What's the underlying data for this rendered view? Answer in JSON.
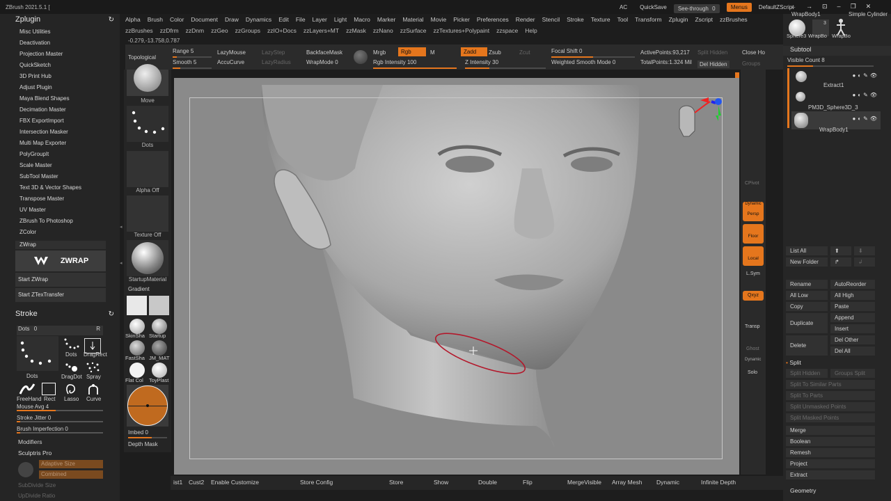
{
  "window": {
    "title": "ZBrush 2021.5.1 ["
  },
  "topright": {
    "ac": "AC",
    "quicksave": "QuickSave",
    "seethrough_label": "See-through",
    "seethrough_value": "0",
    "menus": "Menus",
    "script": "DefaultZScript"
  },
  "menubar": [
    "Alpha",
    "Brush",
    "Color",
    "Document",
    "Draw",
    "Dynamics",
    "Edit",
    "File",
    "Layer",
    "Light",
    "Macro",
    "Marker",
    "Material",
    "Movie",
    "Picker",
    "Preferences",
    "Render",
    "Stencil",
    "Stroke",
    "Texture",
    "Tool",
    "Transform",
    "Zplugin",
    "Zscript",
    "zzBrushes"
  ],
  "pluginbar": [
    "zzBrushes",
    "zzDfrm",
    "zzDnm",
    "zzGeo",
    "zzGroups",
    "zzIO+Docs",
    "zzLayers+MT",
    "zzMask",
    "zzNano",
    "zzSurface",
    "zzTextures+Polypaint",
    "zzspace",
    "Help"
  ],
  "coords": "-0.279,-13.758,0.787",
  "zplugin": {
    "title": "Zplugin",
    "items": [
      "Misc Utilities",
      "Deactivation",
      "Projection Master",
      "QuickSketch",
      "3D Print Hub",
      "Adjust Plugin",
      "Maya Blend Shapes",
      "Decimation Master",
      "FBX ExportImport",
      "Intersection Masker",
      "Multi Map Exporter",
      "PolyGroupIt",
      "Scale Master",
      "SubTool Master",
      "Text 3D & Vector Shapes",
      "Transpose Master",
      "UV Master",
      "ZBrush To Photoshop",
      "ZColor"
    ],
    "zwrap": "ZWrap",
    "zwrap_logo": "ZWRAP",
    "start_zwrap": "Start ZWrap",
    "start_ztex": "Start ZTexTransfer"
  },
  "stroke": {
    "title": "Stroke",
    "dots": "Dots",
    "dots_value": "0",
    "r": "R",
    "labels": [
      "Dots",
      "DragRect",
      "Dots",
      "DragDot",
      "Spray",
      "FreeHand",
      "Rect",
      "Lasso",
      "Curve"
    ],
    "mouse_avg": "Mouse Avg",
    "mouse_avg_value": "4",
    "jitter": "Stroke Jitter",
    "jitter_value": "0",
    "imperfection": "Brush Imperfection",
    "imperfection_value": "0",
    "modifiers": "Modifiers",
    "sculptris": "Sculptris Pro",
    "adaptive": "Adaptive Size",
    "combined": "Combined",
    "subdivide": "SubDivide Size",
    "updivide": "UpDivide Ratio"
  },
  "toolbar": {
    "topological": "Topological",
    "range": "Range",
    "range_value": "5",
    "smooth": "Smooth",
    "smooth_value": "5",
    "lazymouse": "LazyMouse",
    "accucurve": "AccuCurve",
    "lazystep": "LazyStep",
    "lazyradius": "LazyRadius",
    "backfacemask": "BackfaceMask",
    "wrapmode": "WrapMode",
    "wrapmode_value": "0",
    "mrgb": "Mrgb",
    "rgb": "Rgb",
    "m": "M",
    "rgb_intensity": "Rgb Intensity",
    "rgb_intensity_value": "100",
    "zadd": "Zadd",
    "zsub": "Zsub",
    "zcut": "Zcut",
    "z_intensity": "Z Intensity",
    "z_intensity_value": "30",
    "focal": "Focal Shift",
    "focal_value": "0",
    "weighted": "Weighted Smooth Mode",
    "weighted_value": "0",
    "active": "ActivePoints:",
    "active_value": "93,217",
    "total": "TotalPoints:",
    "total_value": "1.324 Mil",
    "split_hidden": "Split Hidden",
    "del_hidden": "Del Hidden",
    "close_holes": "Close Ho",
    "groups": "Groups"
  },
  "shelf": {
    "move": "Move",
    "dots": "Dots",
    "alpha": "Alpha Off",
    "texture": "Texture Off",
    "material": "StartupMaterial",
    "gradient": "Gradient",
    "mats": [
      "SkinSha",
      "Startup",
      "FastSha",
      "JM_MAT",
      "Flat Col",
      "ToyPlast"
    ],
    "imbed": "Imbed",
    "imbed_value": "0",
    "depth": "Depth Mask"
  },
  "rightstrip": {
    "cpivot": "CPivot",
    "persp": "Persp",
    "dynamic": "Dynamic",
    "floor": "Floor",
    "local": "Local",
    "lsym": "L.Sym",
    "xyz": "Qxyz",
    "transp": "Transp",
    "ghost": "Ghost",
    "solo": "Solo",
    "dynamic2": "Dynamic"
  },
  "subtool": {
    "top_names": [
      "WrapBody1",
      "Simple Cylinder",
      "Sphere3",
      "WrapBo",
      "WrapBo"
    ],
    "top_num": "3",
    "title": "Subtool",
    "visible": "Visible Count",
    "visible_value": "8",
    "items": [
      "Extract1",
      "PM3D_Sphere3D_3",
      "WrapBody1"
    ],
    "list_all": "List All",
    "new_folder": "New Folder",
    "rename": "Rename",
    "autoreorder": "AutoReorder",
    "all_low": "All Low",
    "all_high": "All High",
    "copy": "Copy",
    "paste": "Paste",
    "append": "Append",
    "duplicate": "Duplicate",
    "insert": "Insert",
    "del_other": "Del Other",
    "delete": "Delete",
    "del_all": "Del All",
    "split": "Split",
    "split_hidden": "Split Hidden",
    "groups_split": "Groups Split",
    "split_similar": "Split To Similar Parts",
    "split_parts": "Split To Parts",
    "split_unmasked": "Split Unmasked Points",
    "split_masked": "Split Masked Points",
    "merge": "Merge",
    "boolean": "Boolean",
    "remesh": "Remesh",
    "project": "Project",
    "extract": "Extract",
    "geometry": "Geometry"
  },
  "bottom": {
    "cust1": "ist1",
    "cust2": "Cust2",
    "enable": "Enable Customize",
    "store_config": "Store Config",
    "store": "Store",
    "show": "Show",
    "double": "Double",
    "flip": "Flip",
    "mergevisible": "MergeVisible",
    "array": "Array Mesh",
    "dynamic": "Dynamic",
    "infinite": "Infinite Depth"
  },
  "colors": {
    "accent": "#e5761d",
    "canvas": "#8a8a8a",
    "panel": "#252525"
  }
}
